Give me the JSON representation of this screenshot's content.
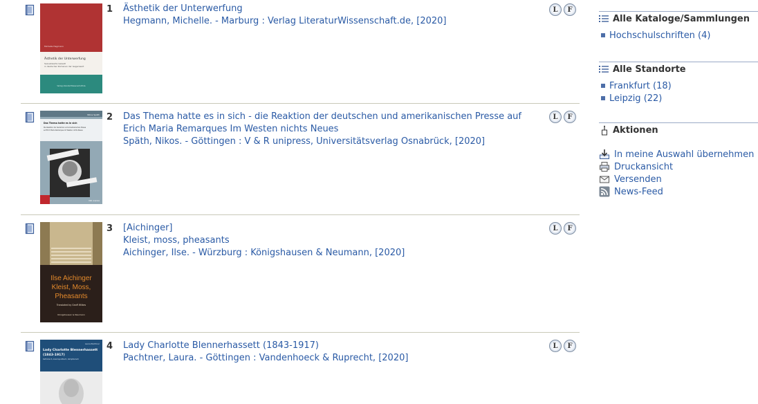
{
  "results": [
    {
      "number": "1",
      "title": "Ästhetik der Unterwerfung",
      "lines": [
        "Hegmann, Michelle. - Marburg : Verlag LiteraturWissenschaft.de, [2020]"
      ],
      "cover": {
        "author": "Michelle Hegmann",
        "title": "Ästhetik der Unterwerfung",
        "subtitle1": "Sexualisierte Gewalt",
        "subtitle2": "in deutscher Romanen der Gegenwart",
        "bottom": "Verlag LiteraturWissenschaft.de"
      },
      "local_label": "L",
      "remote_label": "F"
    },
    {
      "number": "2",
      "title": "Das Thema hatte es in sich - die Reaktion der deutschen und amerikanischen Presse auf Erich Maria Remarques Im Westen nichts Neues",
      "lines": [
        "Späth, Nikos. - Göttingen : V & R unipress, Universitätsverlag Osnabrück, [2020]"
      ],
      "cover": {
        "author": "Nikos Späth",
        "title": "Das Thema hatte es in sich",
        "subtitle1": "Die Reaktion der deutschen und amerikanischen Presse",
        "subtitle2": "auf Erich Maria Remarques Im Westen nichts Neues",
        "bottom": "V&R unipress"
      },
      "local_label": "L",
      "remote_label": "F"
    },
    {
      "number": "3",
      "title": "[Aichinger]",
      "lines": [
        "Kleist, moss, pheasants",
        "Aichinger, Ilse. - Würzburg : Königshausen & Neumann, [2020]"
      ],
      "cover": {
        "author": "Ilse Aichinger",
        "title": "Kleist, Moss,",
        "subtitle1": "Pheasants",
        "subtitle2": "Translated by Geoff Wilkes",
        "bottom": "Königshausen & Neumann"
      },
      "local_label": "L",
      "remote_label": "F"
    },
    {
      "number": "4",
      "title": "Lady Charlotte Blennerhassett (1843-1917)",
      "lines": [
        "Pachtner, Laura. - Göttingen : Vandenhoeck & Ruprecht, [2020]"
      ],
      "cover": {
        "author": "Laura Pachtner",
        "title": "Lady Charlotte Blennerhassett",
        "subtitle1": "(1843-1917)",
        "subtitle2": "Katholisch, kosmopolitisch, kämpferisch",
        "bottom": ""
      },
      "local_label": "L",
      "remote_label": "F"
    }
  ],
  "sidebar": {
    "catalogs": {
      "heading": "Alle Kataloge/Sammlungen",
      "items": [
        {
          "label": "Hochschulschriften (4)"
        }
      ]
    },
    "locations": {
      "heading": "Alle Standorte",
      "items": [
        {
          "label": "Frankfurt (18)"
        },
        {
          "label": "Leipzig (22)"
        }
      ]
    },
    "actions": {
      "heading": "Aktionen",
      "items": [
        {
          "label": "In meine Auswahl übernehmen",
          "icon": "download-icon"
        },
        {
          "label": "Druckansicht",
          "icon": "print-icon"
        },
        {
          "label": "Versenden",
          "icon": "envelope-icon"
        },
        {
          "label": "News-Feed",
          "icon": "rss-icon"
        }
      ]
    }
  },
  "colors": {
    "link": "#2a5aa5",
    "divider": "#c9c9b8",
    "sidebar_rule": "#9aa9c6"
  }
}
